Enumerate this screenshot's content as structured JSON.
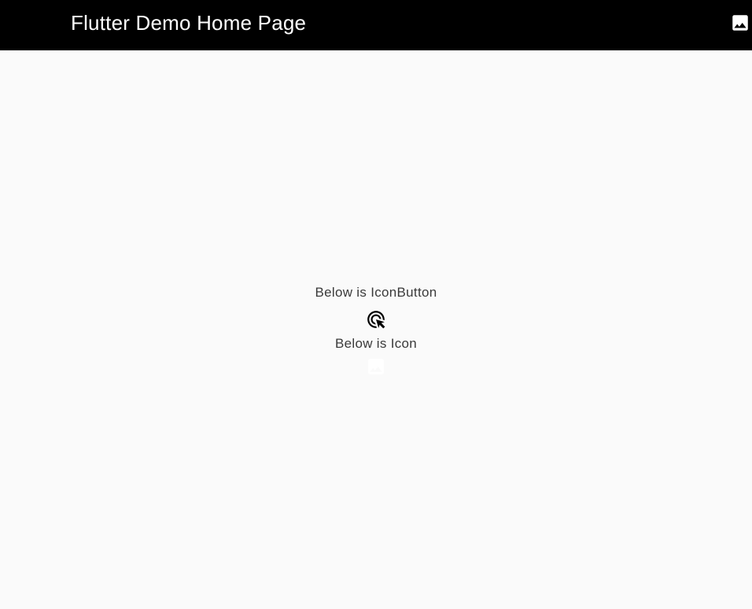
{
  "app_bar": {
    "title": "Flutter Demo Home Page",
    "action_icon": "image-icon",
    "background": "#000000",
    "foreground": "#ffffff"
  },
  "body": {
    "iconbutton_label": "Below is IconButton",
    "iconbutton_icon": "ads-click-icon",
    "icon_label": "Below is Icon",
    "icon_icon": "image-icon",
    "icon_color": "#ffffff"
  }
}
